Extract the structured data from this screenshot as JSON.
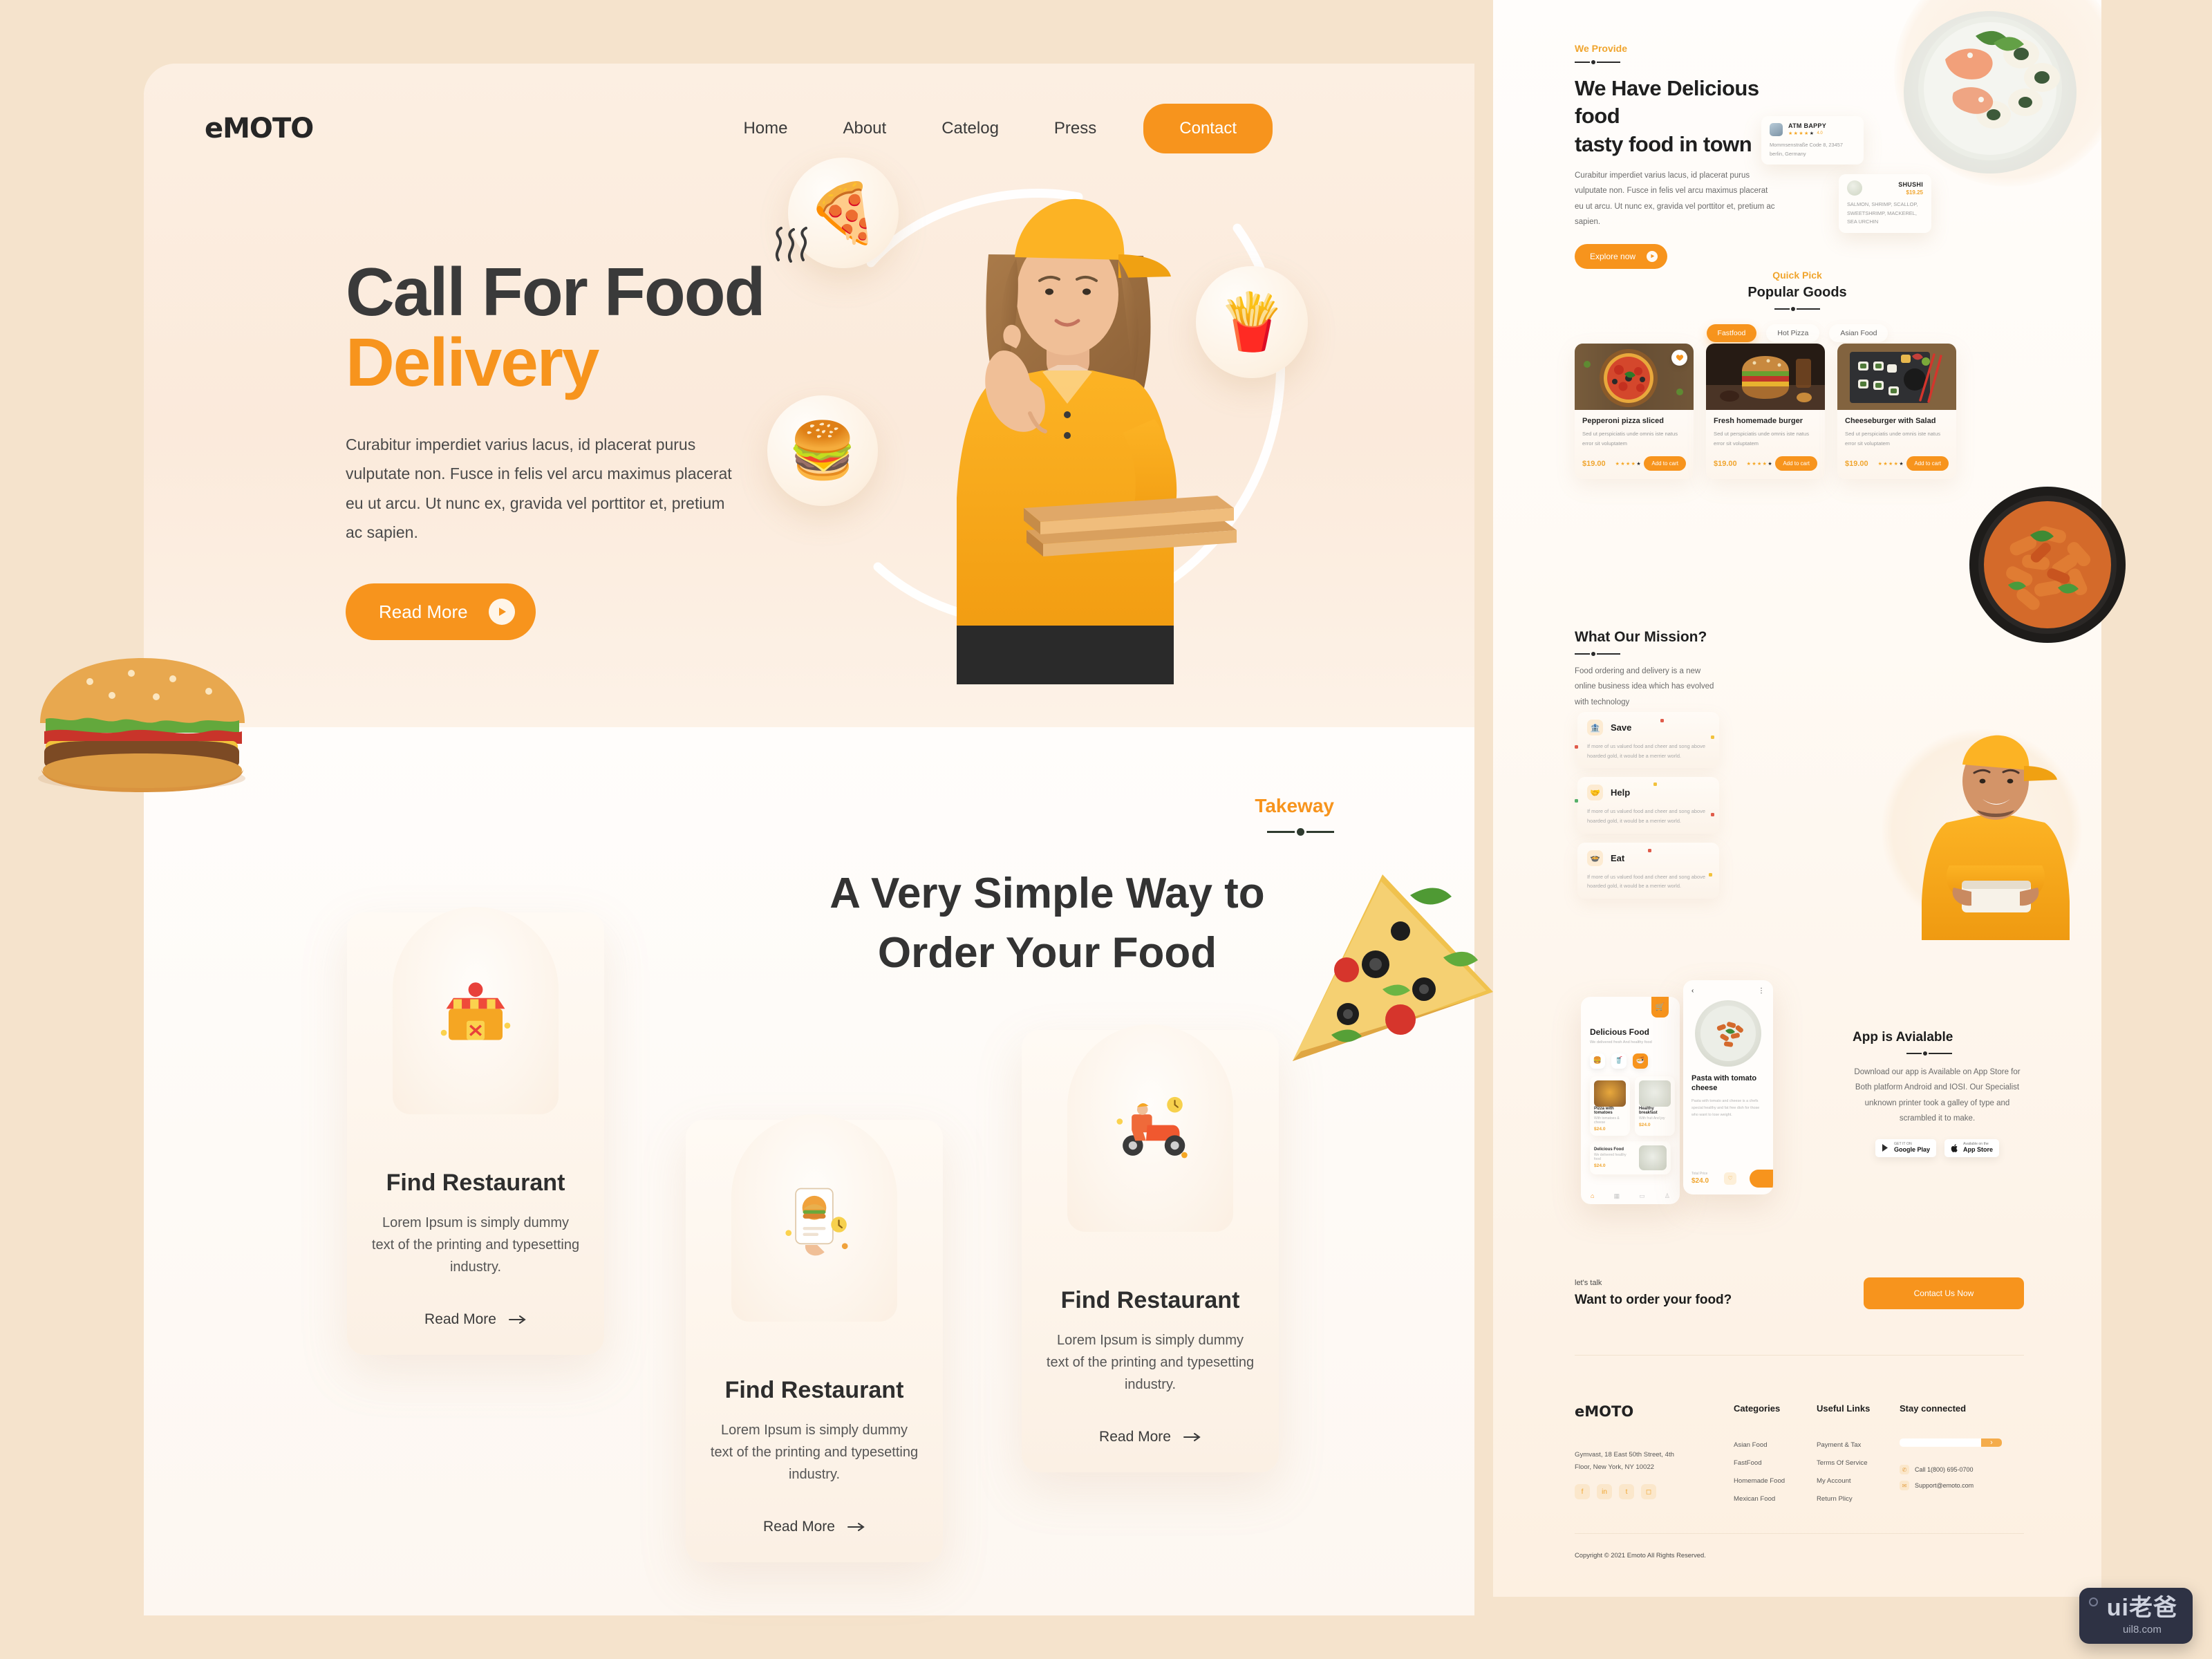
{
  "brand": {
    "name": "eMOTO",
    "accent": "#f7941d"
  },
  "nav": {
    "links": [
      "Home",
      "About",
      "Catelog",
      "Press"
    ],
    "cta": "Contact"
  },
  "hero": {
    "title_line1": "Call For Food",
    "title_line2": "Delivery",
    "paragraph": "Curabitur imperdiet varius lacus, id placerat purus vulputate non. Fusce in felis vel arcu maximus placerat eu ut arcu. Ut nunc ex, gravida vel porttitor et, pretium ac sapien.",
    "cta": "Read More",
    "badges": [
      "pizza-icon",
      "fries-icon",
      "burger-icon"
    ]
  },
  "takeaway": {
    "eyebrow": "Takeway",
    "title_line1": "A Very Simple Way to",
    "title_line2": "Order Your Food",
    "cards": [
      {
        "title": "Find Restaurant",
        "text": "Lorem Ipsum is simply dummy text of the printing and typesetting industry.",
        "link": "Read More",
        "icon": "restaurant-shop-icon"
      },
      {
        "title": "Find Restaurant",
        "text": "Lorem Ipsum is simply dummy text of the printing and typesetting industry.",
        "link": "Read More",
        "icon": "mobile-order-icon"
      },
      {
        "title": "Find Restaurant",
        "text": "Lorem Ipsum is simply dummy text of the printing and typesetting industry.",
        "link": "Read More",
        "icon": "scooter-delivery-icon"
      }
    ]
  },
  "right": {
    "provide": {
      "eyebrow": "We Provide",
      "title_line1": "We Have Delicious food",
      "title_line2": "tasty food in town",
      "paragraph": "Curabitur imperdiet varius lacus, id placerat purus vulputate non. Fusce in felis vel arcu maximus placerat eu ut arcu. Ut nunc ex, gravida vel porttitor et, pretium ac sapien.",
      "cta": "Explore now"
    },
    "review_card": {
      "name": "ATM BAPPY",
      "rating": "4.0",
      "address": "Mommsenstraße  Code 8, 23457 berlin, Germany"
    },
    "dish_card": {
      "name": "SHUSHI",
      "price": "$19.25",
      "desc": "SALMON, SHRIMP, SCALLOP, SWEETSHRIMP, MACKEREL, SEA URCHIN"
    },
    "popular": {
      "eyebrow": "Quick Pick",
      "title": "Popular Goods",
      "tabs": [
        "Fastfood",
        "Hot Pizza",
        "Asian Food"
      ],
      "active_tab": "Fastfood",
      "products": [
        {
          "name": "Pepperoni pizza sliced",
          "desc": "Sed ut perspiciatis unde omnis iste natus error sit voluptatem",
          "price": "$19.00",
          "rating": "4",
          "cta": "Add to cart"
        },
        {
          "name": "Fresh homemade burger",
          "desc": "Sed ut perspiciatis unde omnis iste natus error sit voluptatem",
          "price": "$19.00",
          "rating": "4",
          "cta": "Add to cart"
        },
        {
          "name": "Cheeseburger with Salad",
          "desc": "Sed ut perspiciatis unde omnis iste natus error sit voluptatem",
          "price": "$19.00",
          "rating": "4",
          "cta": "Add to cart"
        }
      ]
    },
    "mission": {
      "title": "What Our Mission?",
      "subtitle": "Food ordering and delivery is a new online business idea which has evolved with technology",
      "items": [
        {
          "title": "Save",
          "text": "If more of us valued food and cheer and song above hoarded gold, it would be a merrier world.",
          "icon": "piggy-bank-icon"
        },
        {
          "title": "Help",
          "text": "If more of us valued food and cheer and song above hoarded gold, it would be a merrier world.",
          "icon": "helping-hands-icon"
        },
        {
          "title": "Eat",
          "text": "If more of us valued food and cheer and song above hoarded gold, it would be a merrier world.",
          "icon": "eat-bowl-icon"
        }
      ]
    },
    "app": {
      "title": "App is Avialable",
      "paragraph": "Download our app is Available on App Store for Both platform Android and IOSI. Our Specialist unknown  printer took a galley  of type and scrambled it to make.",
      "stores": [
        {
          "small": "GET IT ON",
          "big": "Google Play",
          "icon": "google-play-icon"
        },
        {
          "small": "Available on the",
          "big": "App Store",
          "icon": "apple-icon"
        }
      ]
    },
    "phone_app": {
      "screen1": {
        "title": "Delicious Food",
        "subtitle": "We delivered fresh And healthy food",
        "categories": [
          "burger-icon",
          "drink-icon",
          "noodle-icon"
        ],
        "items": [
          {
            "name": "Pizza with tomatoes",
            "desc": "With tomatoes & cheese",
            "price": "$24.0"
          },
          {
            "name": "Healthy breakfast",
            "desc": "With fruit And joy",
            "price": "$24.0"
          },
          {
            "name": "Delicious Food",
            "desc": "We delivered healthy food",
            "price": "$24.0"
          }
        ]
      },
      "screen2": {
        "title": "Pasta with tomato cheese",
        "desc": "Pasta with tomato and cheese is a chefs special healthy and fat free dish for those who want to lose  weight.",
        "price_label": "Total Price",
        "price": "$24.0"
      }
    },
    "contact": {
      "eyebrow": "let's talk",
      "title": "Want to order your food?",
      "cta": "Contact Us Now"
    },
    "footer": {
      "logo": "eMOTO",
      "address": "Gymvast, 18 East 50th Street, 4th Floor, New York, NY 10022",
      "socials": [
        "facebook-icon",
        "linkedin-icon",
        "twitter-icon",
        "instagram-icon"
      ],
      "columns": [
        {
          "heading": "Categories",
          "links": [
            "Asian Food",
            "FastFood",
            "Homemade Food",
            "Mexican Food"
          ]
        },
        {
          "heading": "Useful Links",
          "links": [
            "Payment & Tax",
            "Terms Of Service",
            "My Account",
            "Return Plicy"
          ]
        }
      ],
      "connect": {
        "heading": "Stay connected",
        "input_placeholder": "",
        "phone": "Call 1(800) 695-0700",
        "email": "Support@emoto.com"
      },
      "copyright": "Copyright © 2021 Emoto All Rights Reserved."
    }
  },
  "watermark": {
    "line1": "ui老爸",
    "line2": "uil8.com"
  }
}
